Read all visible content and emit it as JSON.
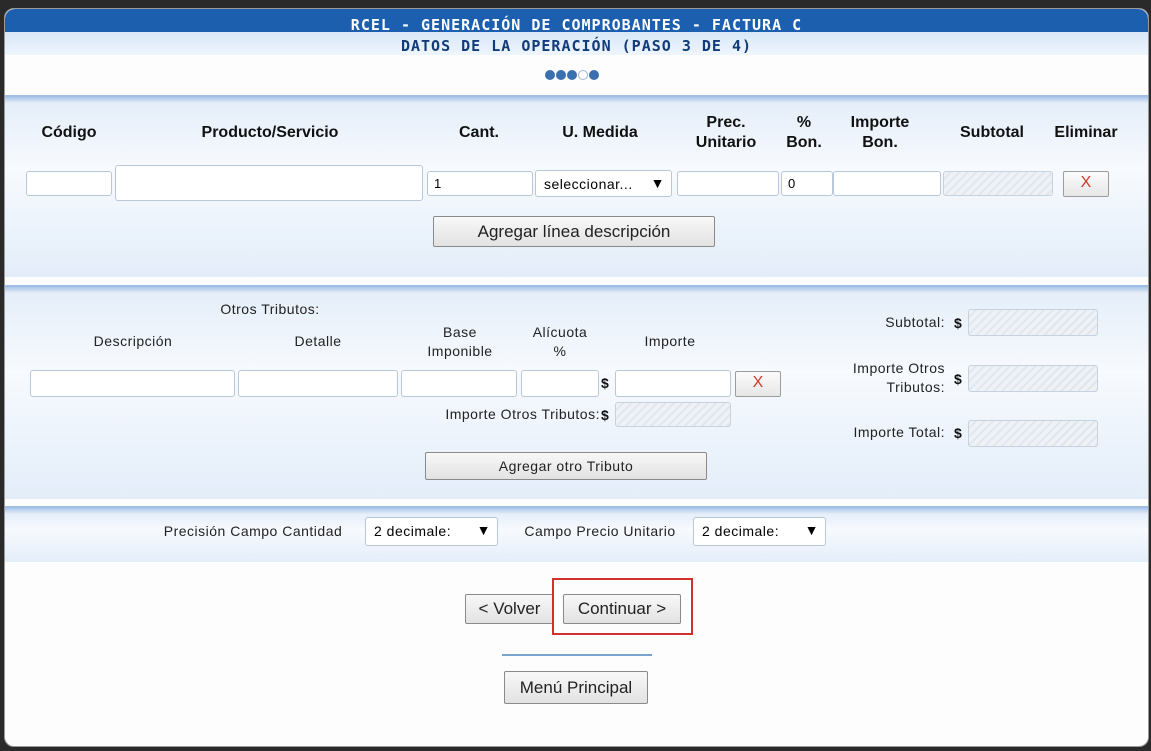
{
  "header": {
    "title": "RCEL - GENERACIÓN DE COMPROBANTES - FACTURA C",
    "subtitle": "DATOS DE LA OPERACIÓN (PASO 3 DE 4)"
  },
  "progress": {
    "total_steps": 5,
    "current_step": 4
  },
  "items_table": {
    "headers": {
      "codigo": "Código",
      "producto": "Producto/Servicio",
      "cant": "Cant.",
      "umedida": "U. Medida",
      "prec_unit": "Prec. Unitario",
      "bon_pct": "% Bon.",
      "importe_bon": "Importe Bon.",
      "subtotal": "Subtotal",
      "eliminar": "Eliminar"
    },
    "row": {
      "codigo": "",
      "producto": "",
      "cant": "1",
      "umedida": "seleccionar...",
      "prec_unit": "",
      "bon_pct": "0",
      "importe_bon": "",
      "subtotal": "",
      "delete_glyph": "X"
    },
    "add_button": "Agregar línea descripción"
  },
  "tributos": {
    "section_label": "Otros Tributos:",
    "headers": {
      "descripcion": "Descripción",
      "detalle": "Detalle",
      "base": "Base Imponible",
      "alicuota": "Alícuota %",
      "importe": "Importe"
    },
    "currency": "$",
    "delete_glyph": "X",
    "importe_otros_label": "Importe Otros Tributos:",
    "add_button": "Agregar otro Tributo"
  },
  "totals": {
    "subtotal_label": "Subtotal:",
    "otros_label": "Importe Otros Tributos:",
    "total_label": "Importe Total:",
    "currency": "$"
  },
  "precision": {
    "cantidad_label": "Precisión Campo Cantidad",
    "cantidad_value": "2 decimale:",
    "precio_label": "Campo Precio Unitario",
    "precio_value": "2 decimale:"
  },
  "nav": {
    "back": "< Volver",
    "continue": "Continuar >",
    "main_menu": "Menú Principal"
  },
  "icons": {
    "dropdown": "dropdown-arrow-icon",
    "delete": "delete-x-icon"
  },
  "colors": {
    "header_blue": "#1b5fae",
    "highlight_red": "#d0312d",
    "delete_red": "#d23a2a"
  }
}
